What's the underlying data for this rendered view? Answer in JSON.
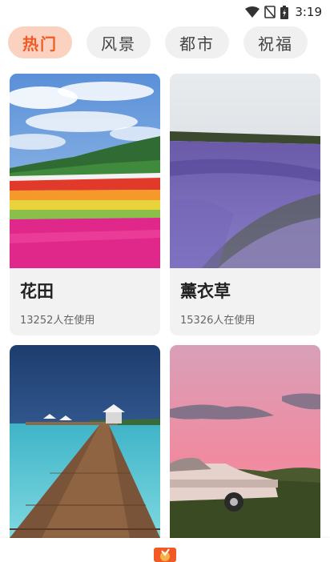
{
  "status_bar": {
    "time": "3:19",
    "icons": [
      "wifi-icon",
      "no-signal-icon",
      "battery-charging-icon"
    ]
  },
  "tabs": [
    {
      "label": "热门",
      "active": true
    },
    {
      "label": "风景",
      "active": false
    },
    {
      "label": "都市",
      "active": false
    },
    {
      "label": "祝福",
      "active": false
    }
  ],
  "cards": [
    {
      "title": "花田",
      "usage": "13252人在使用",
      "image": "flower-field-photo"
    },
    {
      "title": "薰衣草",
      "usage": "15326人在使用",
      "image": "lavender-field-photo"
    },
    {
      "title": "",
      "usage": "",
      "image": "seaside-pier-photo"
    },
    {
      "title": "",
      "usage": "",
      "image": "pink-sky-car-photo"
    }
  ],
  "bottom_nav": {
    "icon": "app-logo-icon"
  },
  "colors": {
    "accent": "#f15a24",
    "accent_bg": "#fbd1c0",
    "tab_bg": "#f0f0f0",
    "card_bg": "#f2f2f2"
  }
}
